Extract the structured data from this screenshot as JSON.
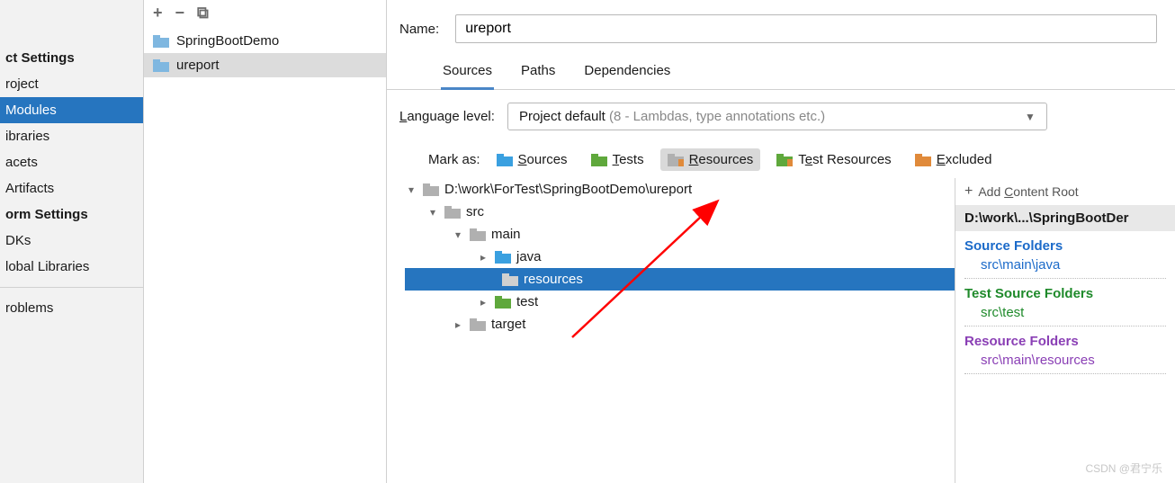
{
  "left_sidebar": {
    "section1": "ct Settings",
    "items1": [
      "roject",
      "Modules",
      "ibraries",
      "acets",
      "Artifacts"
    ],
    "selected1": 1,
    "section2": "orm Settings",
    "items2": [
      "DKs",
      "lobal Libraries"
    ],
    "section3": "roblems"
  },
  "modules": {
    "items": [
      "SpringBootDemo",
      "ureport"
    ],
    "selected": 1
  },
  "name": {
    "label": "Name:",
    "value": "ureport"
  },
  "tabs": [
    "Sources",
    "Paths",
    "Dependencies"
  ],
  "active_tab": 0,
  "language": {
    "label": "Language level:",
    "value": "Project default",
    "hint": "(8 - Lambdas, type annotations etc.)"
  },
  "mark_as": {
    "label": "Mark as:",
    "options": [
      "Sources",
      "Tests",
      "Resources",
      "Test Resources",
      "Excluded"
    ],
    "pressed": 2,
    "colors": [
      "#3aa0e0",
      "#5fa83c",
      "#b0b0b0",
      "#5fa83c",
      "#e08a3a"
    ]
  },
  "tree": [
    {
      "label": "D:\\work\\ForTest\\SpringBootDemo\\ureport",
      "indent": 0,
      "expanded": true,
      "icon": "#b0b0b0"
    },
    {
      "label": "src",
      "indent": 1,
      "expanded": true,
      "icon": "#b0b0b0"
    },
    {
      "label": "main",
      "indent": 2,
      "expanded": true,
      "icon": "#b0b0b0"
    },
    {
      "label": "java",
      "indent": 3,
      "expanded": false,
      "icon": "#3aa0e0"
    },
    {
      "label": "resources",
      "indent": 4,
      "expanded": null,
      "icon": "#8a8a8a",
      "selected": true
    },
    {
      "label": "test",
      "indent": 3,
      "expanded": false,
      "icon": "#5fa83c"
    },
    {
      "label": "target",
      "indent": 2,
      "expanded": false,
      "icon": "#b0b0b0"
    }
  ],
  "content_roots": {
    "add_label": "Add Content Root",
    "root": "D:\\work\\...\\SpringBootDer",
    "groups": [
      {
        "title": "Source Folders",
        "item": "src\\main\\java",
        "cls": "cr-blue"
      },
      {
        "title": "Test Source Folders",
        "item": "src\\test",
        "cls": "cr-green"
      },
      {
        "title": "Resource Folders",
        "item": "src\\main\\resources",
        "cls": "cr-purple"
      }
    ]
  },
  "watermark": "CSDN @君宁乐"
}
